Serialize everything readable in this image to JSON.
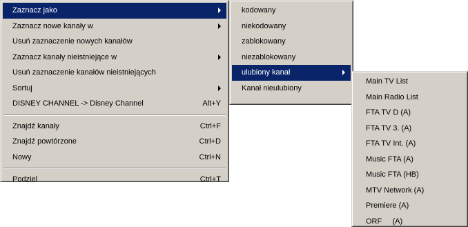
{
  "main_menu": {
    "items": [
      {
        "label": "Zaznacz jako",
        "shortcut": ""
      },
      {
        "label": "Zaznacz nowe kanały w",
        "shortcut": ""
      },
      {
        "label": "Usuń zaznaczenie nowych kanałów",
        "shortcut": ""
      },
      {
        "label": "Zaznacz kanały nieistniejące w",
        "shortcut": ""
      },
      {
        "label": "Usuń zaznaczenie kanałów nieistniejących",
        "shortcut": ""
      },
      {
        "label": "Sortuj",
        "shortcut": ""
      },
      {
        "label": "DISNEY CHANNEL -> Disney Channel",
        "shortcut": "Alt+Y"
      },
      {
        "label": "Znajdź kanały",
        "shortcut": "Ctrl+F"
      },
      {
        "label": "Znajdź powtórzone",
        "shortcut": "Ctrl+D"
      },
      {
        "label": "Nowy",
        "shortcut": "Ctrl+N"
      },
      {
        "label": "Podziel",
        "shortcut": "Ctrl+T"
      }
    ]
  },
  "submenu_mark_as": {
    "items": [
      {
        "label": "kodowany"
      },
      {
        "label": "niekodowany"
      },
      {
        "label": "zablokowany"
      },
      {
        "label": "niezablokowany"
      },
      {
        "label": "ulubiony kanał"
      },
      {
        "label": "Kanał nieulubiony"
      }
    ]
  },
  "submenu_favorites": {
    "items": [
      {
        "label": "Main TV List"
      },
      {
        "label": "Main Radio List"
      },
      {
        "label": "FTA TV D (A)"
      },
      {
        "label": "FTA TV 3. (A)"
      },
      {
        "label": "FTA TV Int. (A)"
      },
      {
        "label": "Music FTA (A)"
      },
      {
        "label": "Music FTA (HB)"
      },
      {
        "label": "MTV Network (A)"
      },
      {
        "label": "Premiere (A)"
      },
      {
        "label": "ORF     (A)"
      }
    ]
  },
  "colors": {
    "menu_background": "#d4d0c8",
    "highlight": "#0a246a",
    "highlight_text": "#ffffff"
  }
}
